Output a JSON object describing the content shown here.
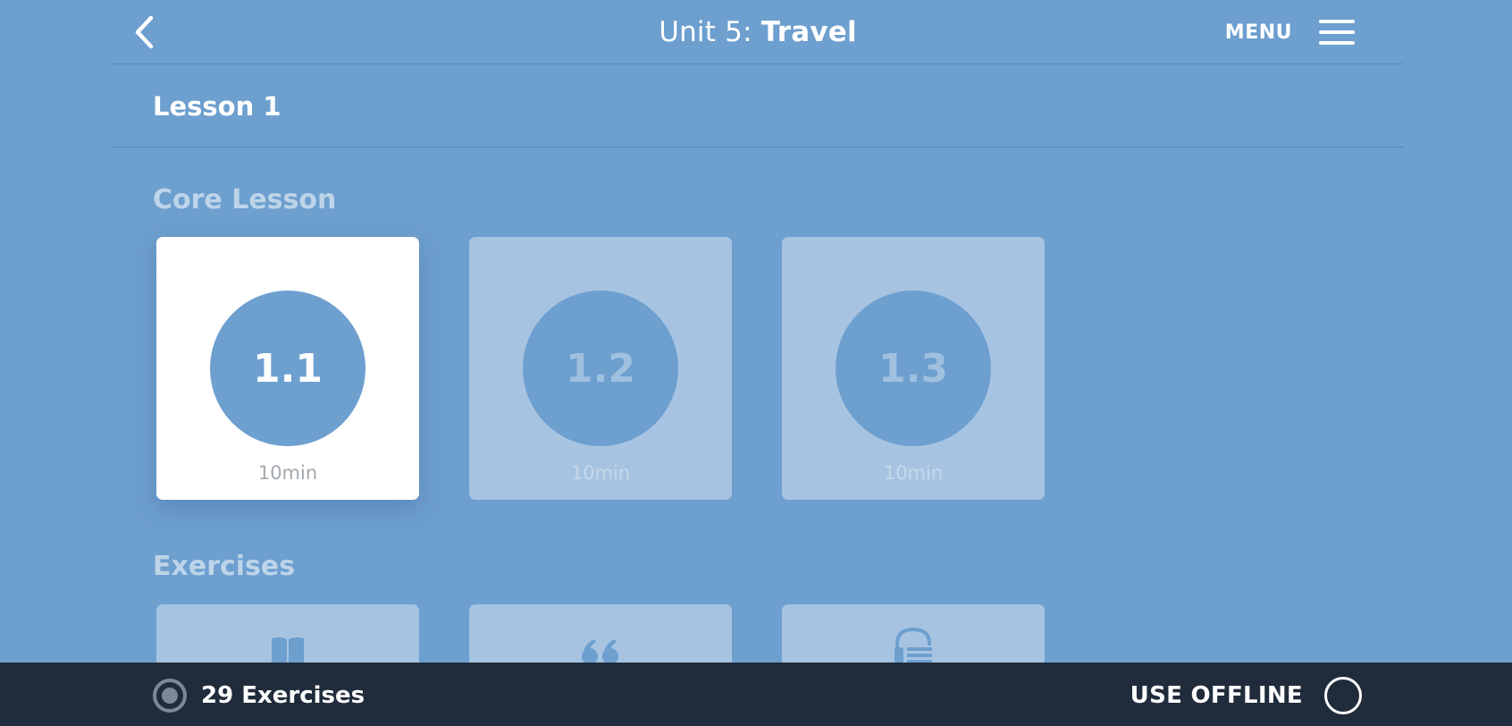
{
  "header": {
    "title_prefix": "Unit 5: ",
    "title_main": "Travel",
    "menu_label": "MENU"
  },
  "lesson": {
    "title": "Lesson 1"
  },
  "core": {
    "heading": "Core Lesson",
    "cards": [
      {
        "number": "1.1",
        "duration": "10min",
        "active": true
      },
      {
        "number": "1.2",
        "duration": "10min",
        "active": false
      },
      {
        "number": "1.3",
        "duration": "10min",
        "active": false
      }
    ]
  },
  "exercises": {
    "heading": "Exercises",
    "cards": [
      {
        "icon": "book-icon"
      },
      {
        "icon": "quote-icon"
      },
      {
        "icon": "headphones-list-icon"
      }
    ]
  },
  "bottom": {
    "exercise_count": "29 Exercises",
    "offline_label": "USE OFFLINE"
  },
  "colors": {
    "background": "#6d9fcf",
    "card_inactive": "#a6c4e1",
    "bottom_bar": "#202c3c"
  }
}
